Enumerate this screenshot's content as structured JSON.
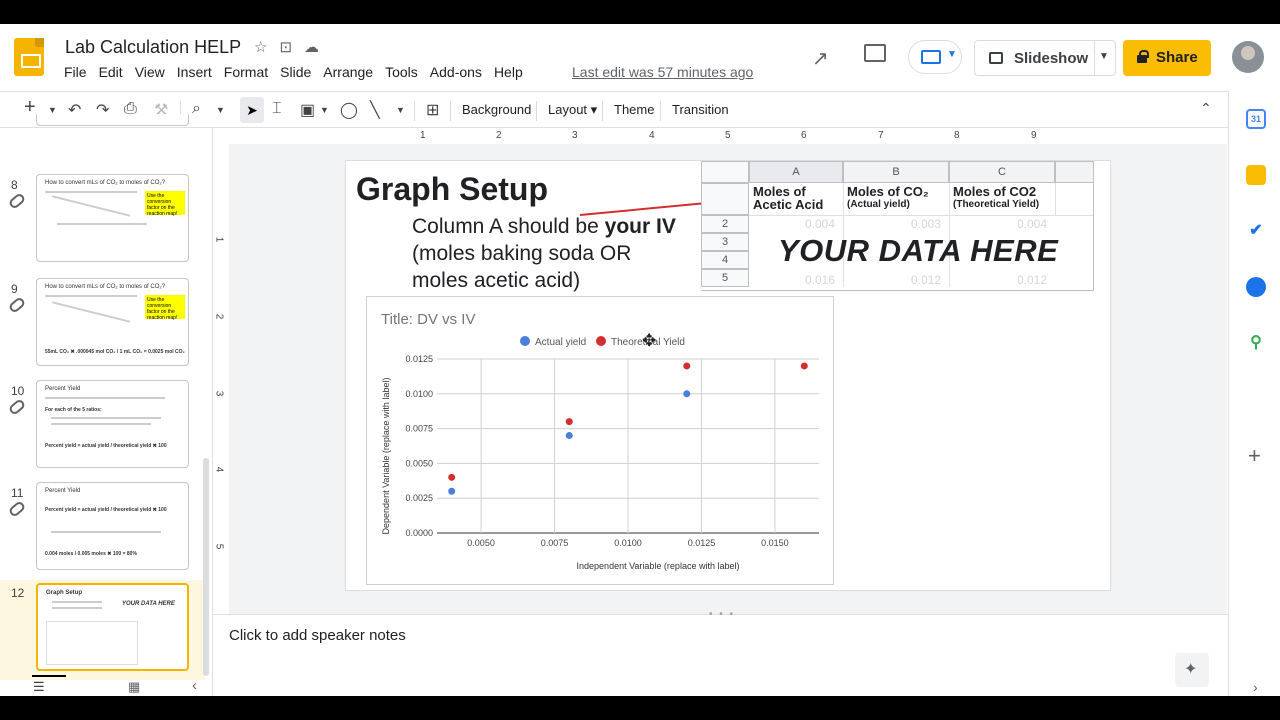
{
  "header": {
    "doc_title": "Lab Calculation HELP",
    "menu": [
      "File",
      "Edit",
      "View",
      "Insert",
      "Format",
      "Slide",
      "Arrange",
      "Tools",
      "Add-ons",
      "Help"
    ],
    "last_edit": "Last edit was 57 minutes ago",
    "slideshow_label": "Slideshow",
    "share_label": "Share",
    "icons": [
      "star-icon",
      "move-folder-icon",
      "cloud-icon",
      "trend-icon",
      "comment-icon",
      "present-icon",
      "lock-icon"
    ]
  },
  "toolbar": {
    "background_label": "Background",
    "layout_label": "Layout",
    "theme_label": "Theme",
    "transition_label": "Transition",
    "icons": [
      "add-icon",
      "undo-icon",
      "redo-icon",
      "print-icon",
      "paint-format-icon",
      "zoom-icon",
      "select-icon",
      "textbox-icon",
      "image-icon",
      "shape-icon",
      "line-icon",
      "new-comment-icon",
      "collapse-icon"
    ]
  },
  "filmstrip": {
    "slides": [
      {
        "num": "8",
        "title": "How to convert mLs of CO₂ to moles of CO₂?",
        "note": "Use the conversion factor on the reaction map!"
      },
      {
        "num": "9",
        "title": "How to convert mLs of CO₂ to moles of CO₂?",
        "note": "Use the conversion factor on the reaction map!",
        "formula": "55mL CO₂ ✖ .000045 mol CO₂ / 1 mL CO₂ = 0.0025 mol CO₂"
      },
      {
        "num": "10",
        "title": "Percent Yield",
        "line1": "For each of the 5 ratios:",
        "line2": "Percent yield = actual yield / theoretical yield ✖ 100"
      },
      {
        "num": "11",
        "title": "Percent Yield",
        "line1": "Percent yield = actual yield / theoretical yield ✖ 100",
        "line2": "0.004 moles / 0.005 moles ✖ 100 = 80%"
      },
      {
        "num": "12",
        "title": "Graph Setup",
        "line1": "YOUR DATA HERE"
      }
    ]
  },
  "slide": {
    "title": "Graph Setup",
    "body_prefix": "Column A should be ",
    "body_bold1": "your",
    "body_bold2": "IV",
    "body_rest": " (moles baking soda OR moles acetic acid)",
    "sheet": {
      "columns": [
        "A",
        "B",
        "C"
      ],
      "rows": [
        "2",
        "3",
        "4",
        "5"
      ],
      "header_a": "Moles of Acetic Acid",
      "header_b": "Moles of CO₂",
      "header_b_sub": "(Actual yield)",
      "header_c": "Moles of CO2",
      "header_c_sub": "(Theoretical Yield)",
      "placeholder": "YOUR DATA HERE",
      "faded_values": [
        "0.004",
        "0.003",
        "0.004",
        "0.016",
        "0.012",
        "0.012"
      ]
    }
  },
  "chart_data": {
    "type": "scatter",
    "title": "Title: DV vs IV",
    "xlabel": "Independent Variable (replace with label)",
    "ylabel": "Dependent Variable (replace with label)",
    "xlim": [
      0.0035,
      0.0165
    ],
    "ylim": [
      0,
      0.0125
    ],
    "xticks": [
      "0.0050",
      "0.0075",
      "0.0100",
      "0.0125",
      "0.0150"
    ],
    "yticks": [
      "0.0000",
      "0.0025",
      "0.0050",
      "0.0075",
      "0.0100",
      "0.0125"
    ],
    "legend_position": "top",
    "grid": true,
    "series": [
      {
        "name": "Actual yield",
        "color": "#4a7ed8",
        "points": [
          [
            0.004,
            0.003
          ],
          [
            0.008,
            0.007
          ],
          [
            0.012,
            0.01
          ]
        ]
      },
      {
        "name": "Theoretical Yield",
        "color": "#d32f2f",
        "points": [
          [
            0.004,
            0.004
          ],
          [
            0.008,
            0.008
          ],
          [
            0.012,
            0.012
          ],
          [
            0.016,
            0.012
          ]
        ]
      }
    ]
  },
  "notes": {
    "placeholder": "Click to add speaker notes"
  }
}
